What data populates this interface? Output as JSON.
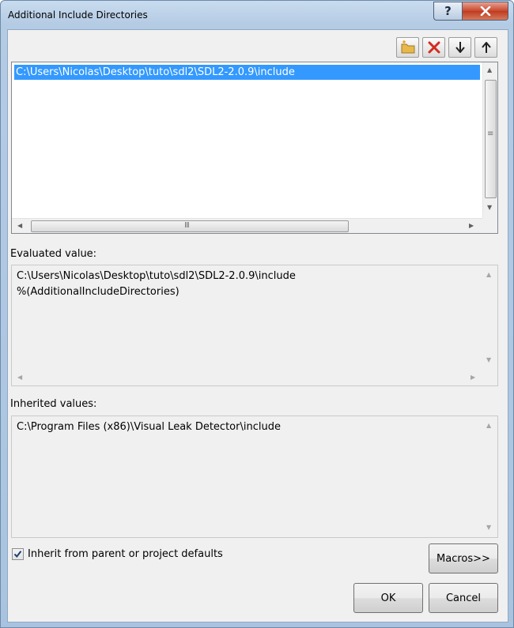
{
  "window": {
    "title": "Additional Include Directories",
    "help_label": "?"
  },
  "toolbar": {
    "icons": [
      "new-line-icon",
      "delete-icon",
      "move-down-icon",
      "move-up-icon"
    ]
  },
  "directory_list": {
    "items": [
      "C:\\Users\\Nicolas\\Desktop\\tuto\\sdl2\\SDL2-2.0.9\\include"
    ],
    "selected_index": 0
  },
  "evaluated": {
    "label": "Evaluated value:",
    "lines": [
      "C:\\Users\\Nicolas\\Desktop\\tuto\\sdl2\\SDL2-2.0.9\\include",
      "%(AdditionalIncludeDirectories)"
    ]
  },
  "inherited": {
    "label": "Inherited values:",
    "lines": [
      "C:\\Program Files (x86)\\Visual Leak Detector\\include"
    ]
  },
  "inherit_checkbox": {
    "label": "Inherit from parent or project defaults",
    "checked": true
  },
  "buttons": {
    "macros": "Macros>>",
    "ok": "OK",
    "cancel": "Cancel"
  },
  "colors": {
    "selection": "#3399ff",
    "delete_icon": "#d42b1e",
    "folder_icon": "#e8b84a"
  }
}
